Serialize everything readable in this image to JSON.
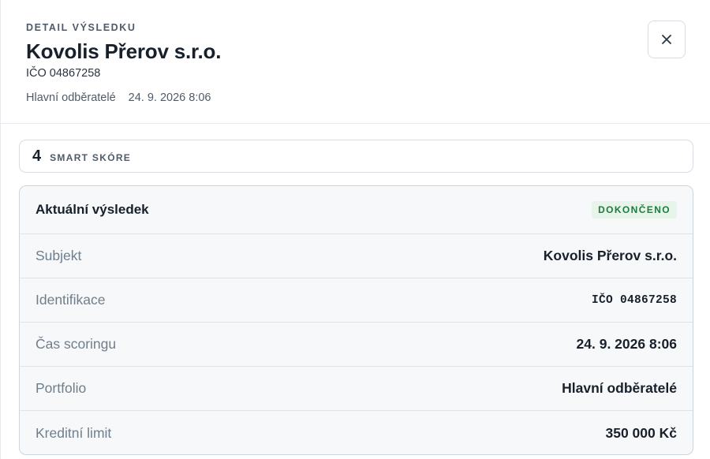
{
  "header": {
    "eyebrow": "DETAIL VÝSLEDKU",
    "company_name": "Kovolis Přerov s.r.o.",
    "ico": "IČO 04867258",
    "portfolio": "Hlavní odběratelé",
    "timestamp": "24. 9. 2026 8:06",
    "close_icon": "close-icon"
  },
  "score": {
    "value": "4",
    "label": "SMART SKÓRE"
  },
  "result": {
    "title": "Aktuální výsledek",
    "status": "DOKONČENO",
    "status_color": "#1f7a3c",
    "rows": [
      {
        "label": "Subjekt",
        "value": "Kovolis Přerov s.r.o."
      },
      {
        "label": "Identifikace",
        "value": "IČO 04867258"
      },
      {
        "label": "Čas scoringu",
        "value": "24. 9. 2026 8:06"
      },
      {
        "label": "Portfolio",
        "value": "Hlavní odběratelé"
      },
      {
        "label": "Kreditní limit",
        "value": "350 000 Kč"
      }
    ]
  }
}
